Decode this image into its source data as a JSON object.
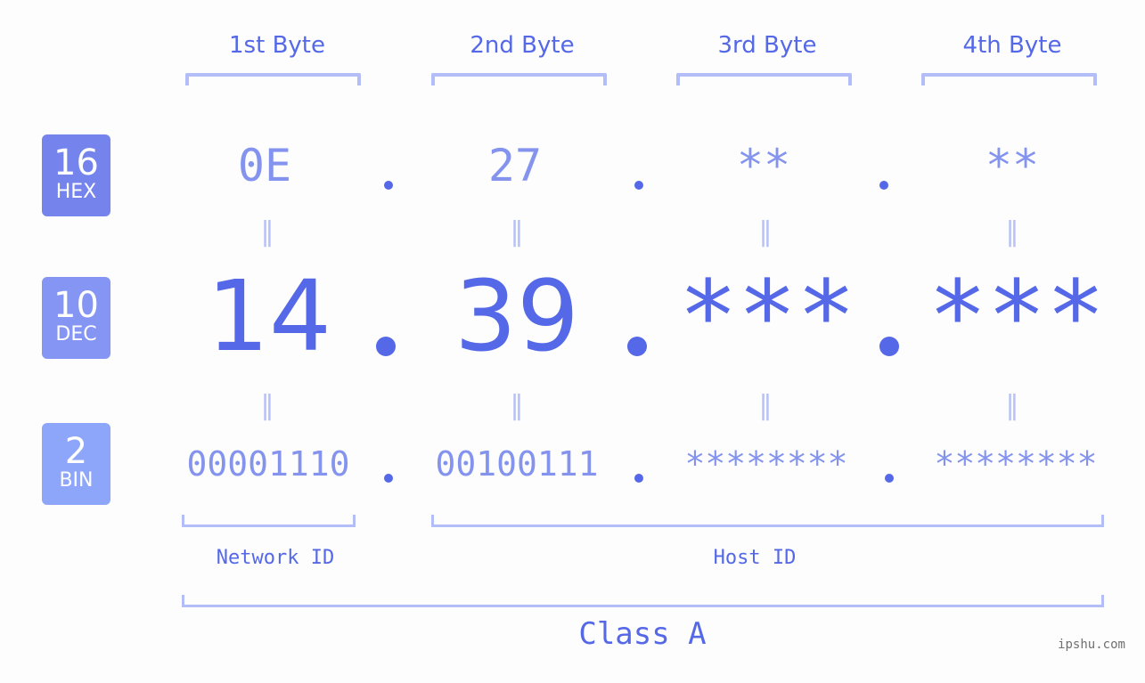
{
  "bytes": [
    {
      "label": "1st Byte",
      "hex": "0E",
      "dec": "14",
      "bin": "00001110"
    },
    {
      "label": "2nd Byte",
      "hex": "27",
      "dec": "39",
      "bin": "00100111"
    },
    {
      "label": "3rd Byte",
      "hex": "**",
      "dec": "***",
      "bin": "********"
    },
    {
      "label": "4th Byte",
      "hex": "**",
      "dec": "***",
      "bin": "********"
    }
  ],
  "bases": {
    "hex": {
      "num": "16",
      "name": "HEX"
    },
    "dec": {
      "num": "10",
      "name": "DEC"
    },
    "bin": {
      "num": "2",
      "name": "BIN"
    }
  },
  "separator": ".",
  "equals": "=",
  "segments": {
    "network": "Network ID",
    "host": "Host ID",
    "class": "Class A"
  },
  "watermark": "ipshu.com",
  "colors": {
    "primary": "#5468e8",
    "light": "#8494ee",
    "bracket": "#b3bdf8",
    "badge_hex": "#7484ec",
    "badge_dec": "#8495f3",
    "badge_bin": "#8ea6fa"
  }
}
